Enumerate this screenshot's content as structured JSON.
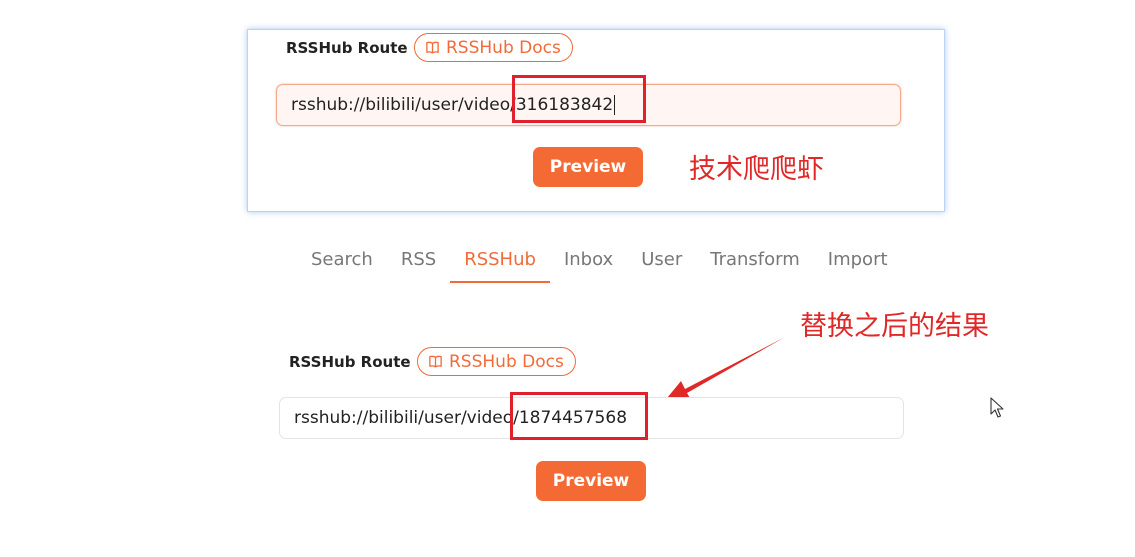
{
  "top_panel": {
    "route_label": "RSSHub Route",
    "docs_label": "RSSHub Docs",
    "route_prefix": "rsshub://bilibili/user/vide",
    "route_tail": "o/316183842",
    "preview_label": "Preview"
  },
  "annotations": {
    "author": "技术爬爬虾",
    "replaced_result": "替换之后的结果"
  },
  "tabs": [
    {
      "label": "Search",
      "active": false
    },
    {
      "label": "RSS",
      "active": false
    },
    {
      "label": "RSSHub",
      "active": true
    },
    {
      "label": "Inbox",
      "active": false
    },
    {
      "label": "User",
      "active": false
    },
    {
      "label": "Transform",
      "active": false
    },
    {
      "label": "Import",
      "active": false
    }
  ],
  "bottom_panel": {
    "route_label": "RSSHub Route",
    "docs_label": "RSSHub Docs",
    "route_prefix": "rsshub://bilibili/user/vide",
    "route_tail": "o/1874457568",
    "preview_label": "Preview"
  },
  "colors": {
    "accent": "#f26a3a",
    "button": "#f46a34",
    "highlight_red": "#e0202a",
    "panel_border": "#b9d3f5"
  },
  "icons": {
    "docs": "book-open-icon",
    "cursor": "mouse-pointer-icon"
  }
}
